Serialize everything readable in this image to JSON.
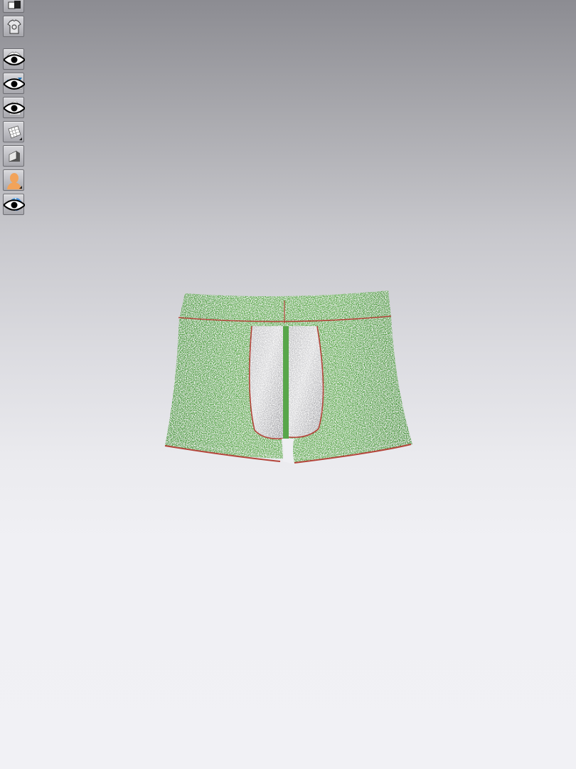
{
  "app": {
    "colors": {
      "background_top": "#8c8c92",
      "background_bottom": "#f1f1f5",
      "garment_fabric": "#5aa44a",
      "garment_panel": "#c9c9cc",
      "seam_line": "#c0392b"
    }
  },
  "toolbar": {
    "tools": [
      {
        "name": "display-mode-icon",
        "has_eye": false,
        "has_corner_arrow": false
      },
      {
        "name": "garment-settings-icon",
        "has_eye": false,
        "has_corner_arrow": false
      },
      {
        "name": "show-garment-icon",
        "has_eye": true,
        "has_corner_arrow": false
      },
      {
        "name": "show-avatar-tools-icon",
        "has_eye": true,
        "has_corner_arrow": false
      },
      {
        "name": "show-avatar-icon",
        "has_eye": true,
        "has_corner_arrow": false
      },
      {
        "name": "texture-grid-icon",
        "has_eye": false,
        "has_corner_arrow": true
      },
      {
        "name": "shaded-surface-icon",
        "has_eye": false,
        "has_corner_arrow": false
      },
      {
        "name": "avatar-skin-icon",
        "has_eye": false,
        "has_corner_arrow": true
      },
      {
        "name": "environment-globe-icon",
        "has_eye": true,
        "has_corner_arrow": false
      }
    ]
  },
  "scene": {
    "object": "trunks-garment"
  }
}
